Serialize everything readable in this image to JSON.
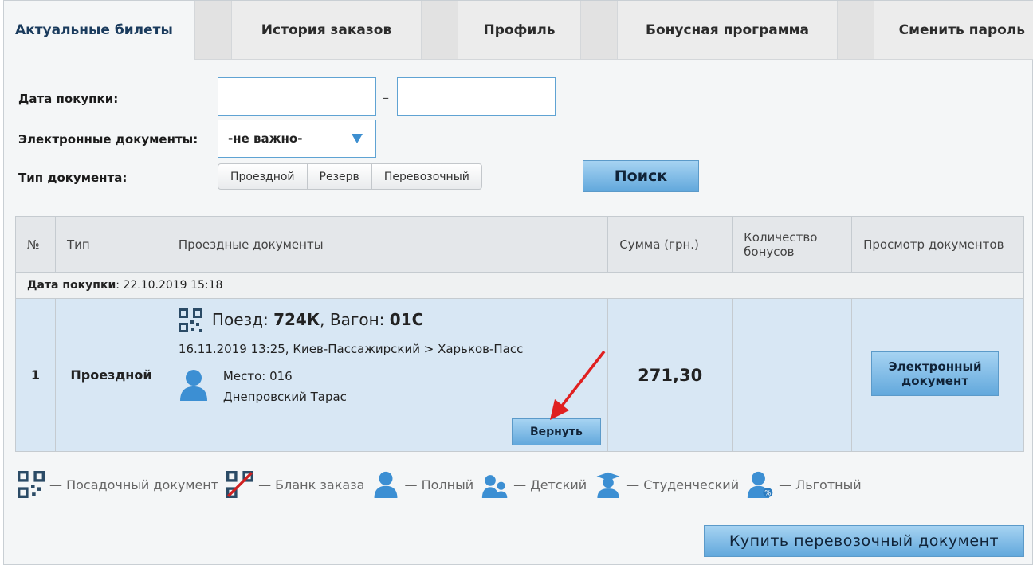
{
  "tabs": [
    {
      "label": "Актуальные билеты",
      "active": true
    },
    {
      "label": "История заказов",
      "active": false
    },
    {
      "label": "Профиль",
      "active": false
    },
    {
      "label": "Бонусная программа",
      "active": false
    },
    {
      "label": "Сменить пароль",
      "active": false
    }
  ],
  "filters": {
    "purchase_date_label": "Дата покупки:",
    "date_from_value": "",
    "date_separator": "–",
    "date_to_value": "",
    "edocs_label": "Электронные документы:",
    "edocs_selected": "-не важно-",
    "doc_type_label": "Тип документа:",
    "doc_type_options": [
      "Проездной",
      "Резерв",
      "Перевозочный"
    ],
    "search_button": "Поиск"
  },
  "table": {
    "headers": {
      "num": "№",
      "type": "Тип",
      "docs": "Проездные документы",
      "sum": "Сумма (грн.)",
      "bonus": "Количество бонусов",
      "view": "Просмотр документов"
    },
    "group_date_label": "Дата покупки",
    "group_date_value": ": 22.10.2019 15:18",
    "rows": [
      {
        "num": "1",
        "type": "Проездной",
        "train_label": "Поезд: ",
        "train_number": "724К",
        "wagon_label": ", Вагон: ",
        "wagon_number": "01С",
        "route": "16.11.2019 13:25, Киев-Пассажирский > Харьков-Пасс",
        "seat": "Место: 016",
        "passenger": "Днепровский Тарас",
        "return_button": "Вернуть",
        "sum": "271,30",
        "bonus": "",
        "view_button_line1": "Электронный",
        "view_button_line2": "документ"
      }
    ]
  },
  "legend": [
    {
      "icon": "qr-boarding-icon",
      "text": "— Посадочный документ"
    },
    {
      "icon": "qr-crossed-icon",
      "text": "— Бланк заказа"
    },
    {
      "icon": "person-full-icon",
      "text": "— Полный"
    },
    {
      "icon": "child-icon",
      "text": "— Детский"
    },
    {
      "icon": "student-icon",
      "text": "— Студенческий"
    },
    {
      "icon": "discount-icon",
      "text": "— Льготный"
    }
  ],
  "buy_button": "Купить перевозочный документ",
  "colors": {
    "accent_blue": "#62a8dc",
    "row_highlight": "#d8e7f4",
    "input_border": "#5fa3d3",
    "annotation_arrow": "#e02020"
  }
}
